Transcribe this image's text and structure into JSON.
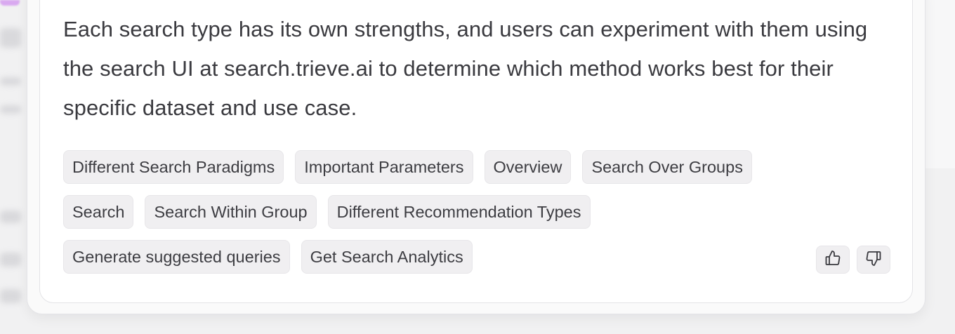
{
  "answer": {
    "text": "Each search type has its own strengths, and users can experiment with them using the search UI at search.trieve.ai to determine which method works best for their specific dataset and use case."
  },
  "sources": [
    [
      "Different Search Paradigms",
      "Important Parameters",
      "Overview",
      "Search Over Groups"
    ],
    [
      "Search",
      "Search Within Group",
      "Different Recommendation Types"
    ],
    [
      "Generate suggested queries",
      "Get Search Analytics"
    ]
  ],
  "feedback": {
    "thumbs_up_icon": "thumbs-up-icon",
    "thumbs_down_icon": "thumbs-down-icon"
  },
  "colors": {
    "tag_bg": "#f0eff1",
    "text": "#3a3a3f",
    "card_bg": "#ffffff"
  }
}
